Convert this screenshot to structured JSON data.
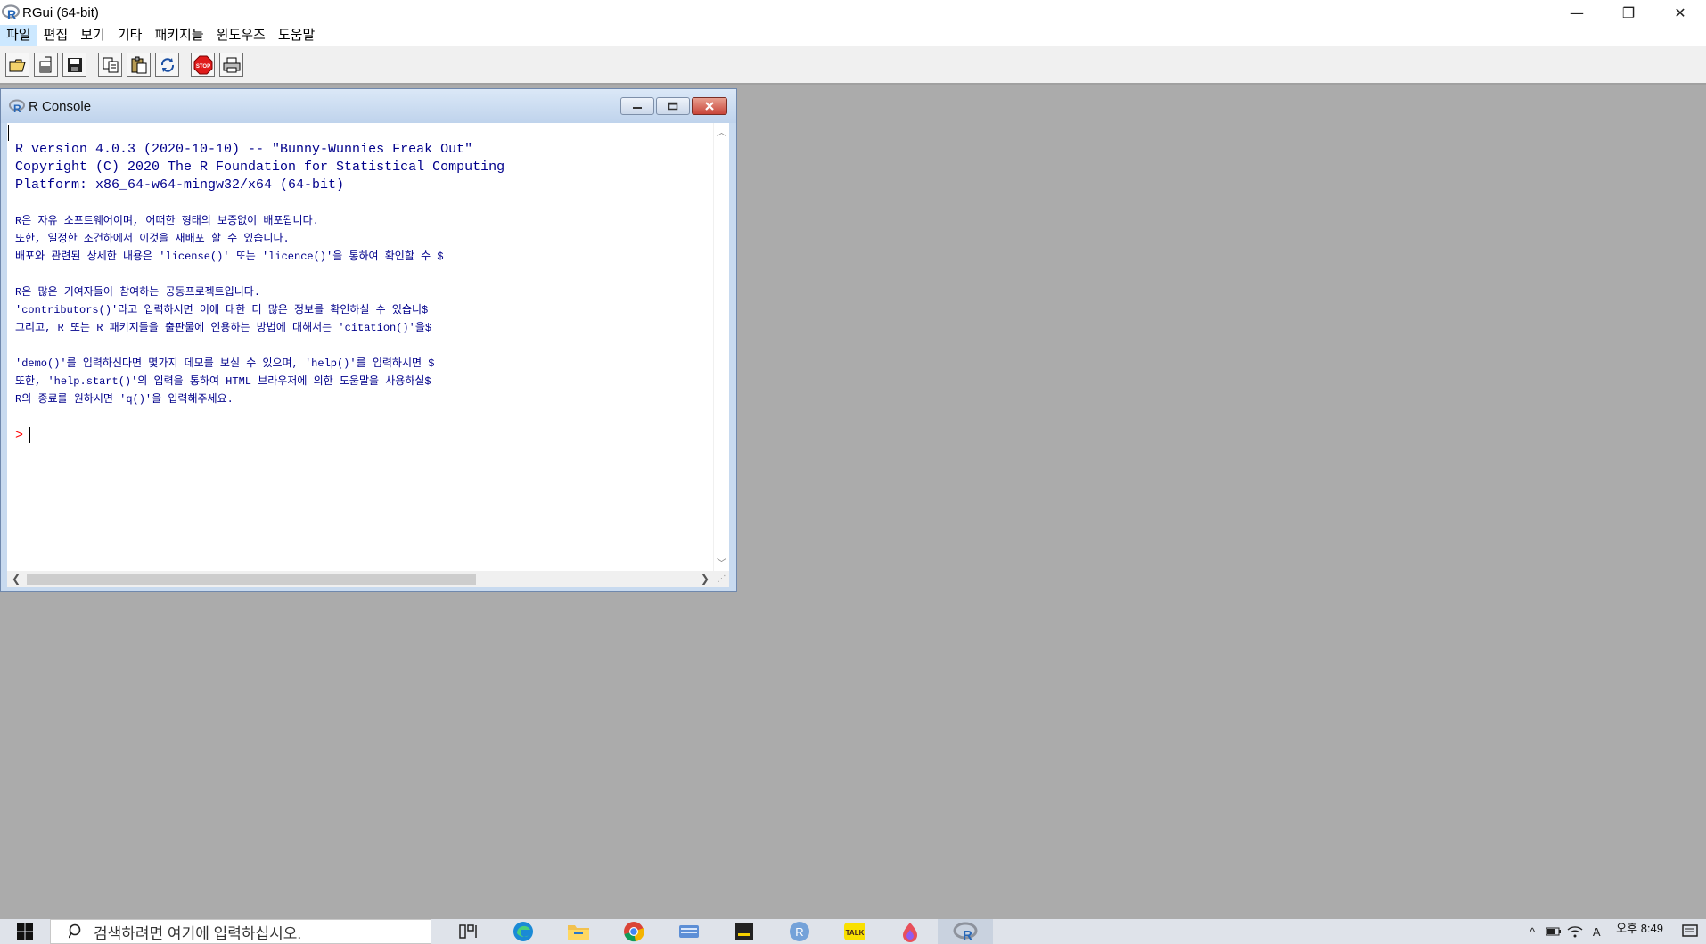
{
  "window": {
    "title": "RGui (64-bit)",
    "minimize_glyph": "—",
    "restore_glyph": "❐",
    "close_glyph": "✕"
  },
  "menu": {
    "items": [
      "파일",
      "편집",
      "보기",
      "기타",
      "패키지들",
      "윈도우즈",
      "도움말"
    ]
  },
  "toolbar": {
    "buttons": [
      "open-script-icon",
      "load-workspace-icon",
      "save-icon",
      "copy-icon",
      "paste-icon",
      "refresh-icon",
      "stop-icon",
      "print-icon"
    ],
    "stop_label": "STOP"
  },
  "console": {
    "title": "R Console",
    "lines": [
      "R version 4.0.3 (2020-10-10) -- \"Bunny-Wunnies Freak Out\"",
      "Copyright (C) 2020 The R Foundation for Statistical Computing",
      "Platform: x86_64-w64-mingw32/x64 (64-bit)",
      "",
      "R은 자유 소프트웨어이며, 어떠한 형태의 보증없이 배포됩니다.",
      "또한, 일정한 조건하에서 이것을 재배포 할 수 있습니다.",
      "배포와 관련된 상세한 내용은 'license()' 또는 'licence()'을 통하여 확인할 수 $",
      "",
      "R은 많은 기여자들이 참여하는 공동프로젝트입니다.",
      "'contributors()'라고 입력하시면 이에 대한 더 많은 정보를 확인하실 수 있습니$",
      "그리고, R 또는 R 패키지들을 출판물에 인용하는 방법에 대해서는 'citation()'을$",
      "",
      "'demo()'를 입력하신다면 몇가지 데모를 보실 수 있으며, 'help()'를 입력하시면 $",
      "또한, 'help.start()'의 입력을 통하여 HTML 브라우저에 의한 도움말을 사용하실$",
      "R의 종료를 원하시면 'q()'을 입력해주세요."
    ],
    "prompt": ">"
  },
  "taskbar": {
    "search_placeholder": "검색하려면 여기에 입력하십시오.",
    "apps": [
      "task-view-icon",
      "edge-icon",
      "file-explorer-icon",
      "chrome-icon",
      "keyboard-app-icon",
      "sticky-app-icon",
      "r-studio-icon",
      "kakaotalk-icon",
      "paint-icon",
      "rgui-icon"
    ],
    "kakao_label": "TALK",
    "r_label": "R",
    "ime_label": "A",
    "clock": "오후 8:49"
  },
  "colors": {
    "console_text": "#00008b",
    "prompt": "#ff0000",
    "mdi_background": "#ababab"
  }
}
